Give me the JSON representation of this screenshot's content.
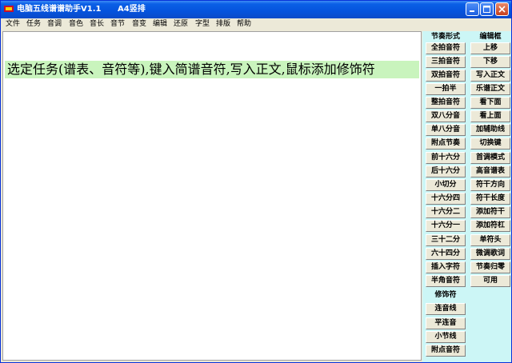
{
  "window": {
    "title": "电脑五线谱谱助手V1.1",
    "mode": "A4竖排"
  },
  "menu": [
    "文件",
    "任务",
    "音调",
    "音色",
    "音长",
    "音节",
    "音变",
    "编辑",
    "还原",
    "字型",
    "排版",
    "帮助"
  ],
  "editor": {
    "prompt": "选定任务(谱表、音符等),键入简谱音符,写入正文,鼠标添加修饰符"
  },
  "panel": {
    "rhythm_header": "节奏形式",
    "edit_header": "编辑框",
    "ornament_header": "修饰符",
    "rhythm_buttons": [
      "全拍音符",
      "三拍音符",
      "双拍音符",
      "一拍半",
      "整拍音符",
      "双八分音",
      "单八分音",
      "附点节奏",
      "前十六分",
      "后十六分",
      "小切分",
      "十六分四",
      "十六分二",
      "十六分一",
      "三十二分",
      "六十四分",
      "插入字符",
      "半角音符"
    ],
    "edit_buttons": [
      "上移",
      "下移",
      "写入正文",
      "乐谱正文",
      "看下面",
      "看上面",
      "加辅助线",
      "切换键",
      "首调模式",
      "高音谱表",
      "符干方向",
      "符干长度",
      "添加符干",
      "添加符杠",
      "单符头",
      "微调歌词",
      "节奏归零",
      "可用"
    ],
    "ornament_buttons": [
      "连音线",
      "平连音",
      "小节线",
      "附点音符"
    ]
  }
}
